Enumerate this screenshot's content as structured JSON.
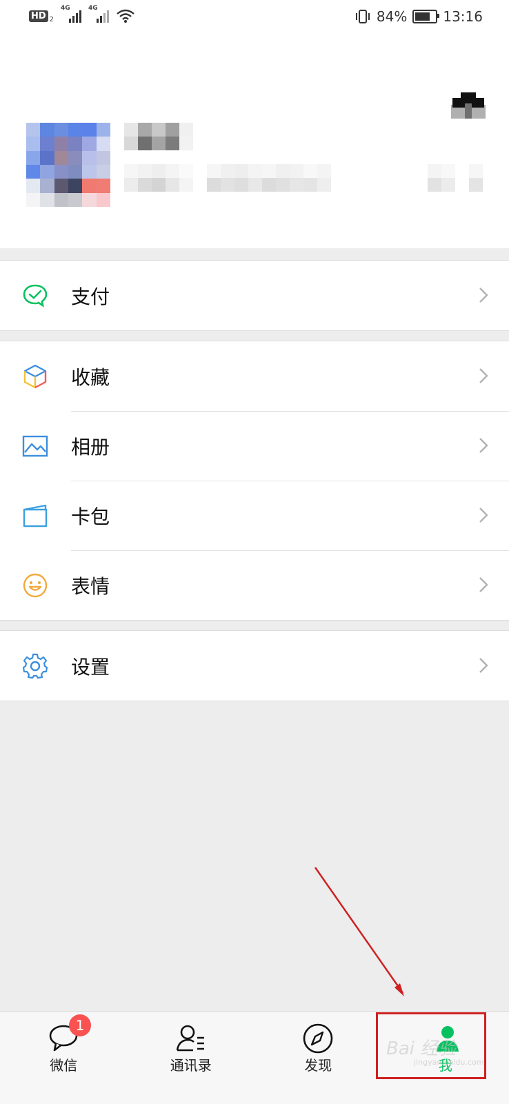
{
  "status_bar": {
    "hd": "HD",
    "hd_sub": "2",
    "net1": "4G",
    "net2": "4G",
    "battery_percent": "84%",
    "battery_level": 0.84,
    "time": "13:16"
  },
  "menu": {
    "pay": "支付",
    "favorites": "收藏",
    "album": "相册",
    "cards": "卡包",
    "stickers": "表情",
    "settings": "设置"
  },
  "tabs": {
    "chats": "微信",
    "chats_badge": "1",
    "contacts": "通讯录",
    "discover": "发现",
    "me": "我"
  },
  "watermark": {
    "main": "Bai 经验",
    "sub": "jingyan.baidu.com"
  },
  "colors": {
    "accent": "#07c160",
    "badge": "#fa5151",
    "annotation": "#d02020"
  }
}
